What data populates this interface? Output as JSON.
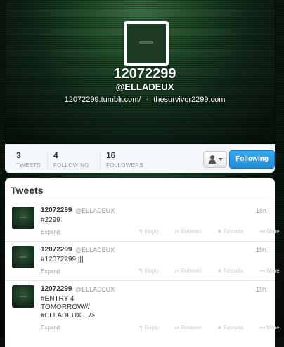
{
  "profile": {
    "name": "12072299",
    "handle": "@ELLADEUX",
    "link1": "12072299.tumblr.com/",
    "separator": "·",
    "link2": "thesurvivor2299.com"
  },
  "stats": [
    {
      "value": "3",
      "label": "TWEETS"
    },
    {
      "value": "4",
      "label": "FOLLOWING"
    },
    {
      "value": "16",
      "label": "FOLLOWERS"
    }
  ],
  "follow_button": "Following",
  "tweets_title": "Tweets",
  "tweet_actions": {
    "reply": "Reply",
    "retweet": "Retweet",
    "favorite": "Favorite",
    "more": "More"
  },
  "icons": {
    "reply": "reply-arrow-icon",
    "retweet": "retweet-icon",
    "favorite": "star-icon",
    "more": "ellipsis-icon",
    "user": "user-dropdown-icon"
  },
  "tweets": [
    {
      "name": "12072299",
      "handle": "@ELLADEUX",
      "time": "18h",
      "text": [
        "#2299"
      ],
      "expand": "Expand"
    },
    {
      "name": "12072299",
      "handle": "@ELLADEUX",
      "time": "19h",
      "text": [
        "#12072299 |||"
      ],
      "expand": "Expand"
    },
    {
      "name": "12072299",
      "handle": "@ELLADEUX",
      "time": "19h",
      "text": [
        "#ENTRY 4",
        "TOMORROW///",
        "#ELLADEUX .../>"
      ],
      "expand": "Expand"
    }
  ],
  "colors": {
    "follow_blue": "#2aa0e8",
    "bg_green": "#1f4a27"
  }
}
